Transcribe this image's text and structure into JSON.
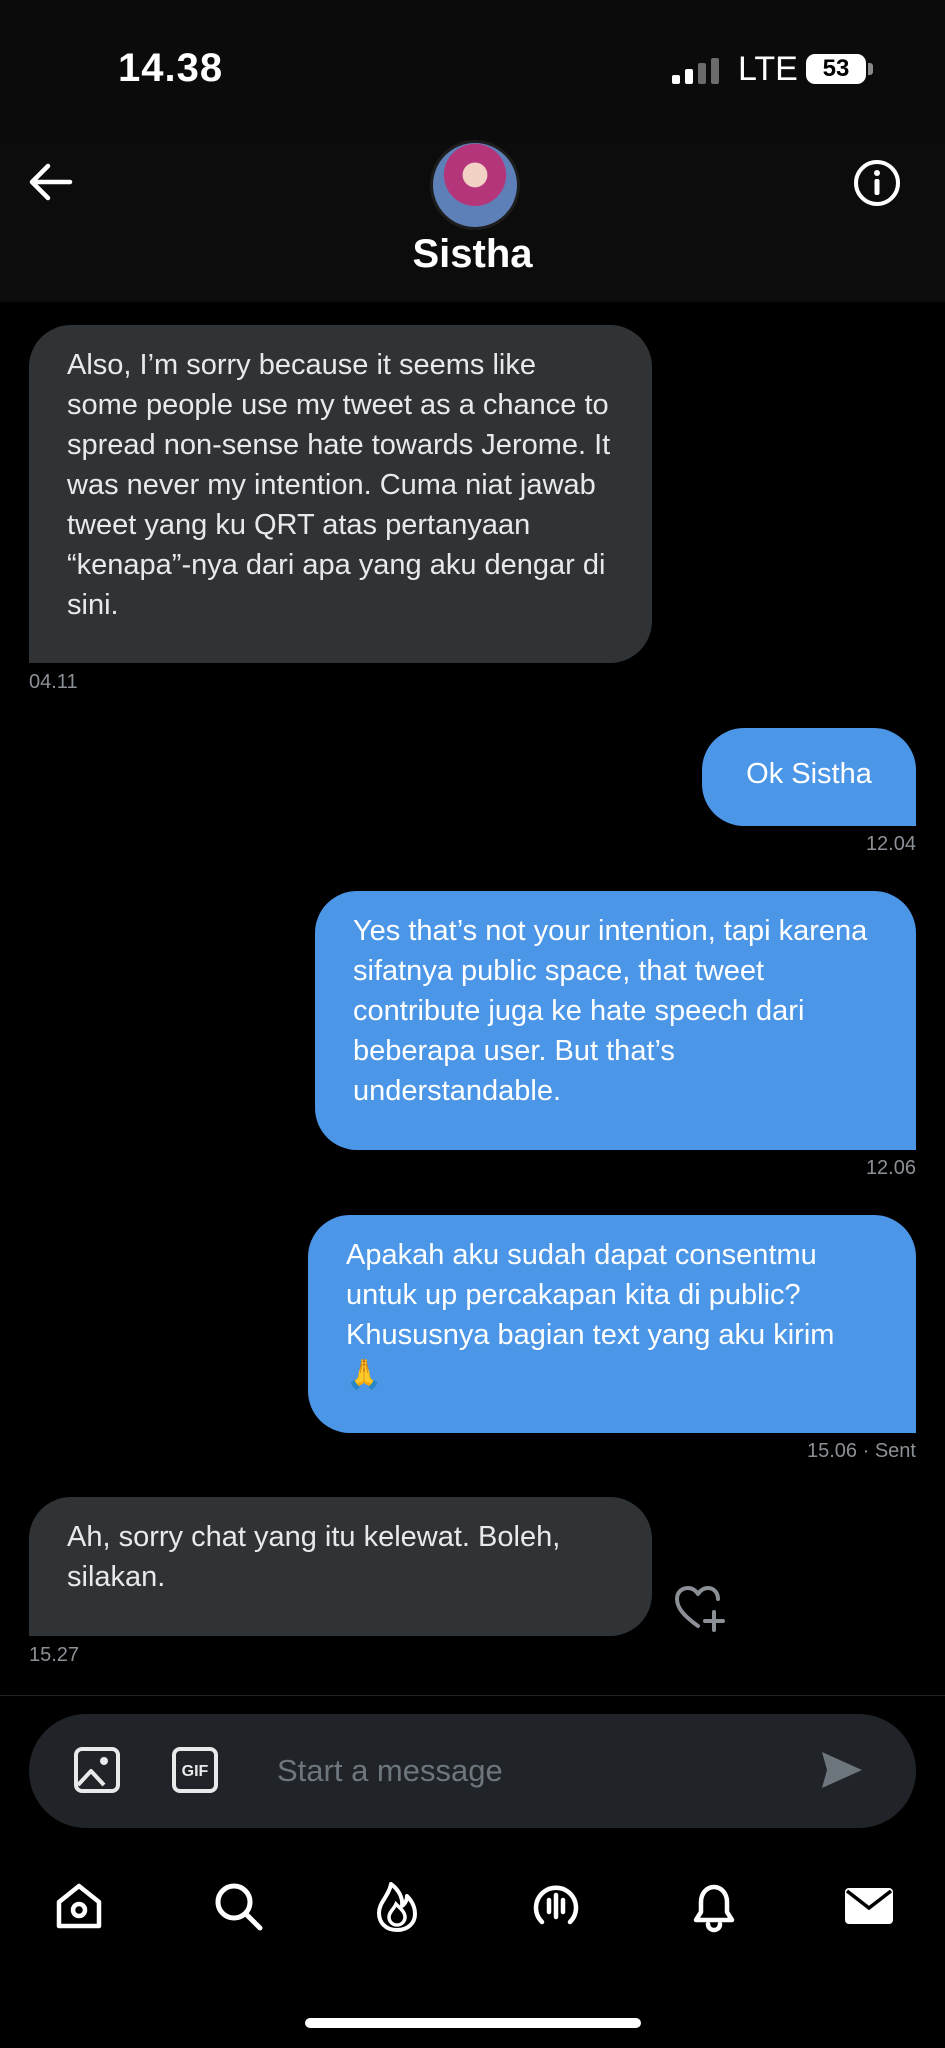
{
  "status_bar": {
    "time": "14.38",
    "network": "LTE",
    "battery": "53"
  },
  "header": {
    "contact_name": "Sistha"
  },
  "messages": [
    {
      "direction": "received",
      "text": "Also, I’m sorry because it seems like some people use my tweet as a chance to spread non-sense hate towards Jerome. It was never my intention. Cuma niat jawab tweet yang ku QRT atas pertanyaan “kenapa”-nya dari apa yang aku dengar di sini.",
      "time": "04.11"
    },
    {
      "direction": "sent",
      "text": "Ok Sistha",
      "time": "12.04"
    },
    {
      "direction": "sent",
      "text": "Yes that’s not your intention, tapi karena sifatnya public space, that tweet contribute juga ke hate speech dari beberapa user. But that’s understandable.",
      "time": "12.06"
    },
    {
      "direction": "sent",
      "text": "Apakah aku sudah dapat consentmu untuk up percakapan kita di public? Khususnya bagian text yang aku kirim 🙏",
      "time": "15.06",
      "status": "Sent"
    },
    {
      "direction": "received",
      "text": "Ah, sorry chat yang itu kelewat. Boleh, silakan.",
      "time": "15.27"
    }
  ],
  "composer": {
    "placeholder": "Start a message",
    "gif_label": "GIF"
  },
  "colors": {
    "sent_bubble": "#4c96e8",
    "received_bubble": "#2f3336",
    "background": "#000000"
  },
  "icons": {
    "header": [
      "back-arrow-icon",
      "info-icon"
    ],
    "composer": [
      "image-icon",
      "gif-icon",
      "send-icon"
    ],
    "message_actions": [
      "heart-plus-icon"
    ],
    "nav": [
      "home-icon",
      "search-icon",
      "fire-icon",
      "spaces-icon",
      "bell-icon",
      "mail-icon"
    ]
  }
}
